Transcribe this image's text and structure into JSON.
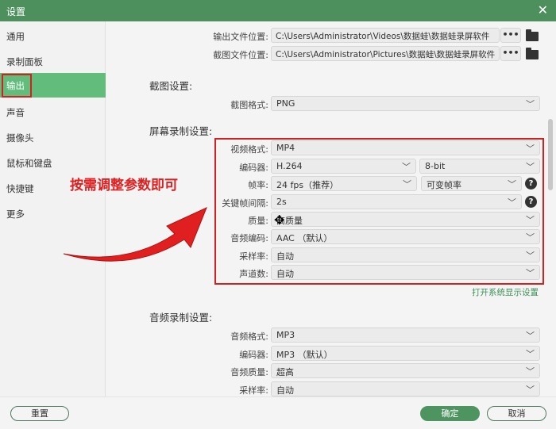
{
  "window": {
    "title": "设置",
    "close_icon": "close-icon"
  },
  "sidebar": {
    "items": [
      {
        "label": "通用"
      },
      {
        "label": "录制面板"
      },
      {
        "label": "输出",
        "active": true
      },
      {
        "label": "声音"
      },
      {
        "label": "摄像头"
      },
      {
        "label": "鼠标和键盘"
      },
      {
        "label": "快捷键"
      },
      {
        "label": "更多"
      }
    ]
  },
  "paths": {
    "output_label": "输出文件位置:",
    "output_value": "C:\\Users\\Administrator\\Videos\\数据蛙\\数据蛙录屏软件",
    "screenshot_label": "截图文件位置:",
    "screenshot_value": "C:\\Users\\Administrator\\Pictures\\数据蛙\\数据蛙录屏软件",
    "browse_label": "•••"
  },
  "screenshot": {
    "title": "截图设置:",
    "format_label": "截图格式:",
    "format_value": "PNG"
  },
  "screen": {
    "title": "屏幕录制设置:",
    "rows": [
      {
        "label": "视频格式:",
        "value": "MP4"
      },
      {
        "label": "编码器:",
        "value": "H.264",
        "value2": "8-bit"
      },
      {
        "label": "帧率:",
        "value": "24 fps（推荐）",
        "value2": "可变帧率"
      },
      {
        "label": "关键帧间隔:",
        "value": "2s"
      },
      {
        "label": "质量:",
        "value": "高质量"
      },
      {
        "label": "音频编码:",
        "value": "AAC （默认）"
      },
      {
        "label": "采样率:",
        "value": "自动"
      },
      {
        "label": "声道数:",
        "value": "自动"
      }
    ],
    "link": "打开系统显示设置",
    "help": "?"
  },
  "audio": {
    "title": "音频录制设置:",
    "rows": [
      {
        "label": "音频格式:",
        "value": "MP3"
      },
      {
        "label": "编码器:",
        "value": "MP3 （默认）"
      },
      {
        "label": "音频质量:",
        "value": "超高"
      },
      {
        "label": "采样率:",
        "value": "自动"
      }
    ]
  },
  "annotation": {
    "text": "按需调整参数即可",
    "color": "#e02020"
  },
  "footer": {
    "reset": "重置",
    "ok": "确定",
    "cancel": "取消"
  },
  "colors": {
    "accent": "#4e8f5e",
    "active": "#62bc7b"
  }
}
